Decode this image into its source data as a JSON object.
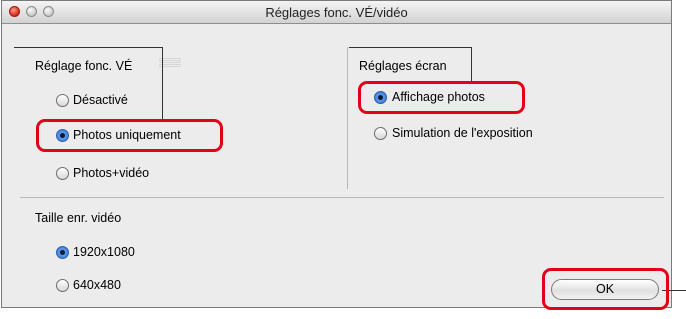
{
  "window": {
    "title": "Réglages fonc. VÉ/vidéo"
  },
  "live_view_group": {
    "heading": "Réglage fonc. VÉ",
    "options": [
      {
        "label": "Désactivé",
        "selected": false
      },
      {
        "label": "Photos uniquement",
        "selected": true,
        "highlighted": true
      },
      {
        "label": "Photos+vidéo",
        "selected": false
      }
    ]
  },
  "screen_group": {
    "heading": "Réglages écran",
    "options": [
      {
        "label": "Affichage photos",
        "selected": true,
        "highlighted": true
      },
      {
        "label": "Simulation de l'exposition",
        "selected": false
      }
    ]
  },
  "video_size_group": {
    "heading": "Taille enr. vidéo",
    "options": [
      {
        "label": "1920x1080",
        "selected": true
      },
      {
        "label": "640x480",
        "selected": false
      }
    ]
  },
  "buttons": {
    "ok_label": "OK"
  },
  "colors": {
    "highlight": "#e3001b",
    "window_bg": "#ececec",
    "radio_selected": "#2a6fd0"
  }
}
